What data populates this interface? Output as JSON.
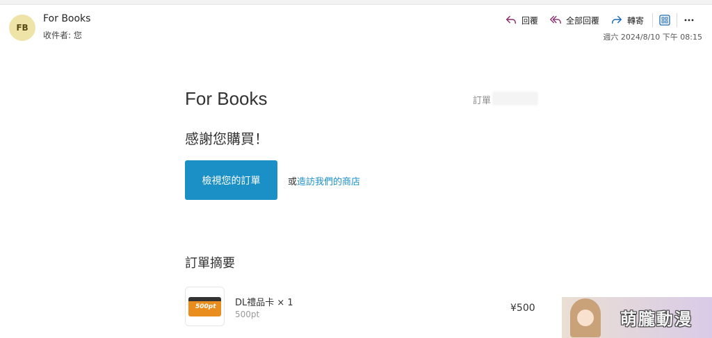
{
  "header": {
    "avatar_initials": "FB",
    "sender": "For Books",
    "recipient_line": "收件者: 您",
    "actions": {
      "reply": "回覆",
      "reply_all": "全部回覆",
      "forward": "轉寄"
    },
    "timestamp": "週六 2024/8/10 下午 08:15"
  },
  "email": {
    "brand": "For Books",
    "order_label": "訂單",
    "thanks": "感謝您購買！",
    "view_order_button": "檢視您的訂單",
    "or_text": "或",
    "store_link": "造訪我們的商店",
    "summary_title": "訂單摘要",
    "item": {
      "name": "DL禮品卡 × 1",
      "sub": "500pt",
      "card_text": "500pt",
      "price": "¥500"
    }
  },
  "watermark": {
    "text": "萌朧動漫"
  },
  "colors": {
    "accent": "#1b90c7",
    "reply_icon": "#8a2c6e",
    "forward_icon": "#1b6bb5",
    "avatar_bg": "#efe4a8"
  }
}
